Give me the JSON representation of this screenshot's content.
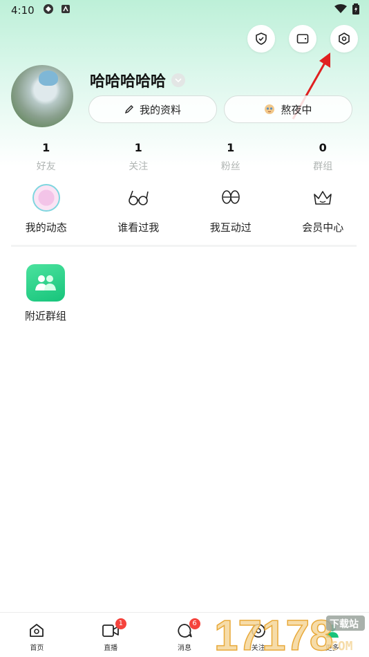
{
  "status_bar": {
    "time": "4:10"
  },
  "profile": {
    "username": "哈哈哈哈哈",
    "edit_profile_label": "我的资料",
    "status_label": "熬夜中"
  },
  "stats": [
    {
      "value": "1",
      "label": "好友"
    },
    {
      "value": "1",
      "label": "关注"
    },
    {
      "value": "1",
      "label": "粉丝"
    },
    {
      "value": "0",
      "label": "群组"
    }
  ],
  "features": [
    {
      "label": "我的动态",
      "icon": "moments-icon"
    },
    {
      "label": "谁看过我",
      "icon": "glasses-icon"
    },
    {
      "label": "我互动过",
      "icon": "footprints-icon"
    },
    {
      "label": "会员中心",
      "icon": "crown-icon"
    }
  ],
  "nearby_group": {
    "label": "附近群组",
    "icon": "group-icon"
  },
  "bottom_nav": [
    {
      "label": "首页",
      "icon": "home-icon",
      "badge": ""
    },
    {
      "label": "直播",
      "icon": "video-icon",
      "badge": "1"
    },
    {
      "label": "消息",
      "icon": "message-icon",
      "badge": "6"
    },
    {
      "label": "关注",
      "icon": "follow-icon",
      "badge": ""
    },
    {
      "label": "更多",
      "icon": "profile-icon",
      "badge": ""
    }
  ],
  "watermark": {
    "text": "17178",
    "subtext": "下载站",
    "domain": "COM"
  },
  "colors": {
    "accent": "#17c47b",
    "badge": "#f5433d",
    "annotation_arrow": "#e02020"
  }
}
